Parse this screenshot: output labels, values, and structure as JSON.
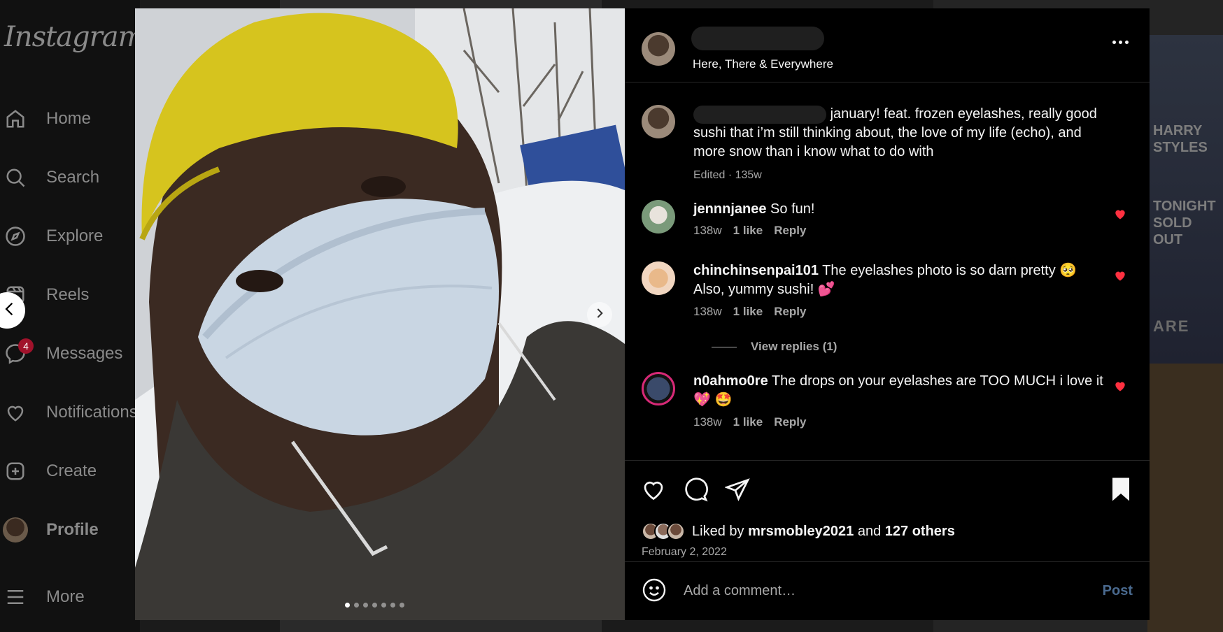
{
  "app": {
    "logo": "Instagram"
  },
  "nav": {
    "items": [
      {
        "label": "Home",
        "icon": "home-icon"
      },
      {
        "label": "Search",
        "icon": "search-icon"
      },
      {
        "label": "Explore",
        "icon": "compass-icon"
      },
      {
        "label": "Reels",
        "icon": "reels-icon"
      },
      {
        "label": "Messages",
        "icon": "messenger-icon",
        "badge": "4"
      },
      {
        "label": "Notifications",
        "icon": "heart-icon"
      },
      {
        "label": "Create",
        "icon": "plus-square-icon"
      },
      {
        "label": "Profile",
        "icon": "avatar"
      },
      {
        "label": "More",
        "icon": "menu-icon"
      }
    ]
  },
  "background": {
    "poster_text": "HARRY STYLES",
    "poster_text_2": "TONIGHT SOLD OUT",
    "feed_text": "ARE"
  },
  "post": {
    "location": "Here, There & Everywhere",
    "caption": "january! feat. frozen eyelashes, really good sushi that i’m still thinking about, the love of my life (echo), and more snow than i know what to do with",
    "caption_meta": "Edited · 135w",
    "image_count": 7,
    "active_image": 1
  },
  "comments": [
    {
      "user": "jennnjanee",
      "text": "So fun!",
      "age": "138w",
      "likes": "1 like",
      "reply": "Reply"
    },
    {
      "user": "chinchinsenpai101",
      "text": "The eyelashes photo is so darn pretty 🥺 Also, yummy sushi! 💕",
      "age": "138w",
      "likes": "1 like",
      "reply": "Reply",
      "view_replies": "View replies (1)"
    },
    {
      "user": "n0ahmo0re",
      "text": "The drops on your eyelashes are TOO MUCH i love it 💖 🤩",
      "age": "138w",
      "likes": "1 like",
      "reply": "Reply"
    }
  ],
  "likes": {
    "prefix": "Liked by",
    "user": "mrsmobley2021",
    "and": "and",
    "others": "127 others"
  },
  "date": "February 2, 2022",
  "composer": {
    "placeholder": "Add a comment…",
    "post_label": "Post"
  },
  "colors": {
    "like_red": "#ff3040",
    "accent_blue": "#4a6a8f"
  }
}
